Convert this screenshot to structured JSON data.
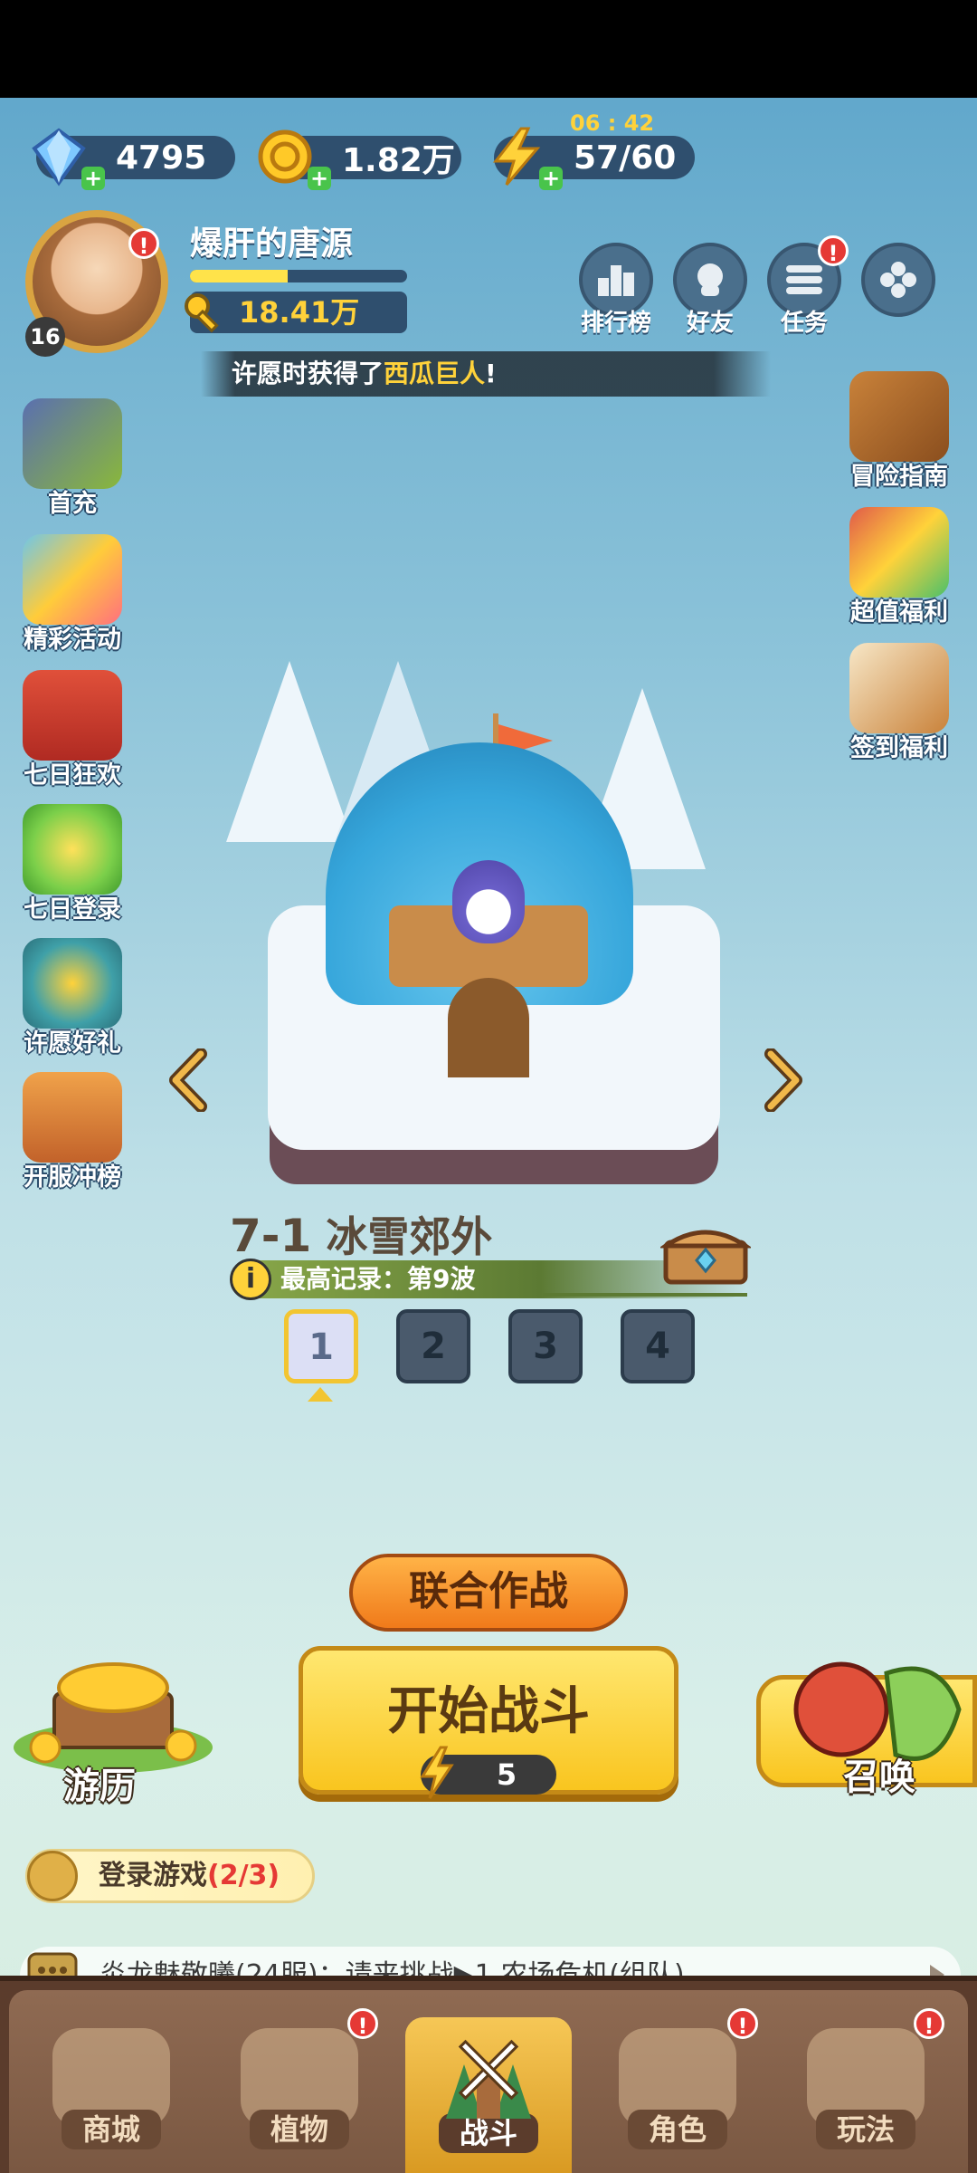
{
  "resources": {
    "gems": "4795",
    "coins": "1.82万",
    "energy": "57/60",
    "energy_timer": "06 : 42"
  },
  "player": {
    "name": "爆肝的唐源",
    "level": "16",
    "power": "18.41万",
    "exp_fraction": 0.45
  },
  "top_buttons": [
    {
      "label": "排行榜",
      "icon": "leaderboard-icon"
    },
    {
      "label": "好友",
      "icon": "friends-icon"
    },
    {
      "label": "任务",
      "icon": "tasks-icon"
    },
    {
      "label": "",
      "icon": "more-menu-icon"
    }
  ],
  "marquee": {
    "prefix": "许愿时获得了",
    "highlight": "西瓜巨人",
    "suffix": "!"
  },
  "left_events": [
    {
      "label": "首充"
    },
    {
      "label": "精彩活动"
    },
    {
      "label": "七日狂欢"
    },
    {
      "label": "七日登录"
    },
    {
      "label": "许愿好礼"
    },
    {
      "label": "开服冲榜"
    }
  ],
  "right_events": [
    {
      "label": "冒险指南"
    },
    {
      "label": "超值福利"
    },
    {
      "label": "签到福利"
    }
  ],
  "stage": {
    "code": "7-1",
    "name": "冰雪郊外",
    "record": "最高记录：第9波",
    "waves": [
      "1",
      "2",
      "3",
      "4"
    ],
    "selected_wave": "1"
  },
  "buttons": {
    "coop": "联合作战",
    "start": "开始战斗",
    "start_cost": "5",
    "travel": "游历",
    "summon": "召唤"
  },
  "quest": {
    "label": "登录游戏",
    "progress": "(2/3)"
  },
  "chat": {
    "text": "炎龙魅敬曦(24服)：请来挑战▶1.农场危机(组队)"
  },
  "nav": {
    "items": [
      {
        "label": "商城"
      },
      {
        "label": "植物"
      },
      {
        "label": "战斗"
      },
      {
        "label": "角色"
      },
      {
        "label": "玩法"
      }
    ],
    "active": "战斗"
  },
  "colors": {
    "accent_yellow": "#f9c51f",
    "alert_red": "#e53935",
    "panel_dark": "#2f4f6e"
  }
}
